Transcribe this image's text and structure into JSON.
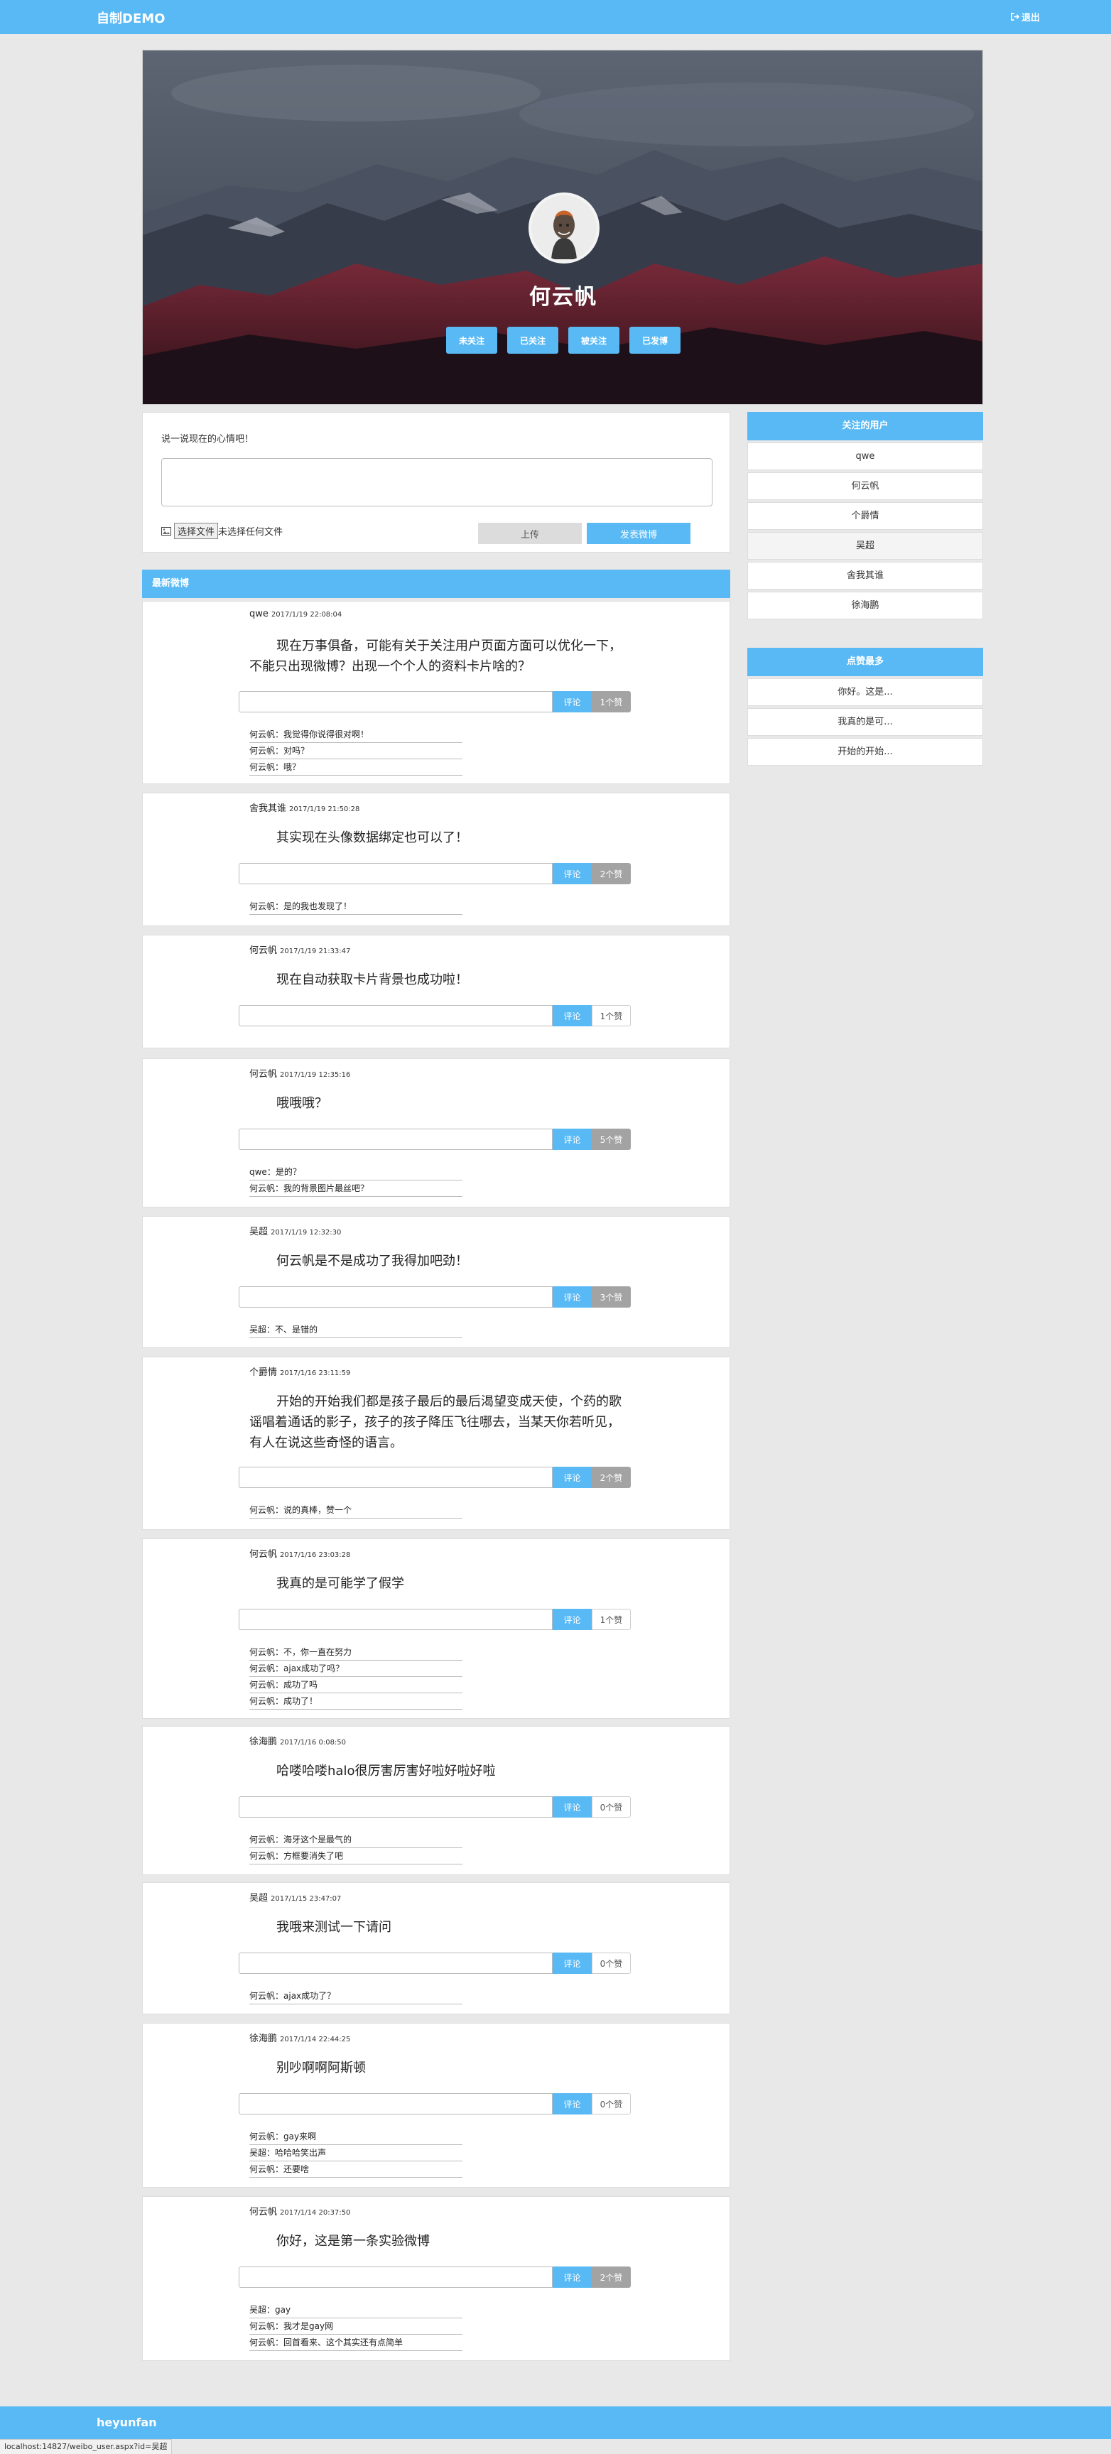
{
  "header": {
    "brand": "自制DEMO",
    "logout": "退出"
  },
  "profile": {
    "name": "何云帆",
    "buttons": [
      "未关注",
      "已关注",
      "被关注",
      "已发博"
    ]
  },
  "composer": {
    "hint": "说一说现在的心情吧！",
    "file_button": "选择文件",
    "file_status": "未选择任何文件",
    "upload": "上传",
    "publish": "发表微博"
  },
  "feed": {
    "title": "最新微博",
    "comment_label": "评论",
    "posts": [
      {
        "author": "qwe",
        "time": "2017/1/19 22:08:04",
        "content": "现在万事俱备，可能有关于关注用户页面方面可以优化一下，不能只出现微博？出现一个个人的资料卡片啥的？",
        "likes": "1个赞",
        "liked": true,
        "comments": [
          "何云帆：我觉得你说得很对啊！",
          "何云帆：对吗？",
          "何云帆：哦？"
        ]
      },
      {
        "author": "舍我其谁",
        "time": "2017/1/19 21:50:28",
        "content": "其实现在头像数据绑定也可以了！",
        "likes": "2个赞",
        "liked": true,
        "comments": [
          "何云帆：是的我也发现了！"
        ]
      },
      {
        "author": "何云帆",
        "time": "2017/1/19 21:33:47",
        "content": "现在自动获取卡片背景也成功啦！",
        "likes": "1个赞",
        "liked": false,
        "comments": []
      },
      {
        "author": "何云帆",
        "time": "2017/1/19 12:35:16",
        "content": "哦哦哦？",
        "likes": "5个赞",
        "liked": true,
        "comments": [
          "qwe：是的？",
          "何云帆：我的背景图片最丝吧？"
        ]
      },
      {
        "author": "吴超",
        "time": "2017/1/19 12:32:30",
        "content": "何云帆是不是成功了我得加吧劲！",
        "likes": "3个赞",
        "liked": true,
        "comments": [
          "吴超：不、是错的"
        ]
      },
      {
        "author": "个爵情",
        "time": "2017/1/16 23:11:59",
        "content": "开始的开始我们都是孩子最后的最后渴望变成天使，个药的歌谣唱着通话的影子，孩子的孩子降压飞往哪去，当某天你若听见，有人在说这些奇怪的语言。",
        "likes": "2个赞",
        "liked": true,
        "comments": [
          "何云帆：说的真棒，赞一个"
        ]
      },
      {
        "author": "何云帆",
        "time": "2017/1/16 23:03:28",
        "content": "我真的是可能学了假学",
        "likes": "1个赞",
        "liked": false,
        "comments": [
          "何云帆：不，你一直在努力",
          "何云帆：ajax成功了吗？",
          "何云帆：成功了吗",
          "何云帆：成功了！"
        ]
      },
      {
        "author": "徐海鹏",
        "time": "2017/1/16 0:08:50",
        "content": "哈喽哈喽halo很厉害厉害好啦好啦好啦",
        "likes": "0个赞",
        "liked": false,
        "comments": [
          "何云帆：海牙这个是最气的",
          "何云帆：方框要消失了吧"
        ]
      },
      {
        "author": "吴超",
        "time": "2017/1/15 23:47:07",
        "content": "我哦来测试一下请问",
        "likes": "0个赞",
        "liked": false,
        "comments": [
          "何云帆：ajax成功了？"
        ]
      },
      {
        "author": "徐海鹏",
        "time": "2017/1/14 22:44:25",
        "content": "别吵啊啊阿斯顿",
        "likes": "0个赞",
        "liked": false,
        "comments": [
          "何云帆：gay来啊",
          "吴超：哈哈哈笑出声",
          "何云帆：还要啥"
        ]
      },
      {
        "author": "何云帆",
        "time": "2017/1/14 20:37:50",
        "content": "你好，这是第一条实验微博",
        "likes": "2个赞",
        "liked": true,
        "comments": [
          "吴超：gay",
          "何云帆：我才是gay网",
          "何云帆：回首看来、这个其实还有点简单"
        ]
      }
    ]
  },
  "sidebar": {
    "following_title": "关注的用户",
    "following": [
      "qwe",
      "何云帆",
      "个爵情",
      "吴超",
      "舍我其谁",
      "徐海鹏"
    ],
    "top_title": "点赞最多",
    "top": [
      "你好。这是...",
      "我真的是可...",
      "开始的开始..."
    ]
  },
  "footer": {
    "text": "heyunfan"
  },
  "status_url": "localhost:14827/weibo_user.aspx?id=吴超",
  "colors": {
    "accent": "#58b9f5",
    "liked": "#a3a3a3"
  }
}
